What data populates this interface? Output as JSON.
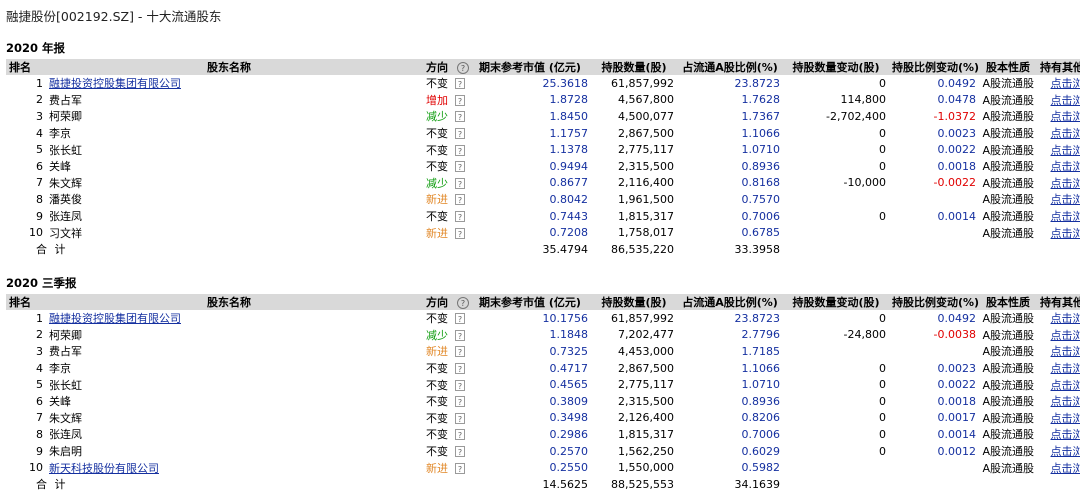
{
  "page": {
    "title": "融捷股份[002192.SZ] - 十大流通股东"
  },
  "columns": {
    "rank": "排名",
    "name": "股东名称",
    "direction": "方向",
    "help": "?",
    "market_value": "期末参考市值 (亿元)",
    "shares": "持股数量(股)",
    "ratio": "占流通A股比例(%)",
    "share_change": "持股数量变动(股)",
    "ratio_change": "持股比例变动(%)",
    "nature": "股本性质",
    "other": "持有其他股票"
  },
  "sections": [
    {
      "title": "2020 年报",
      "rows": [
        {
          "rank": "1",
          "name": "融捷投资控股集团有限公司",
          "linked": true,
          "direction": "不变",
          "dir_type": "same",
          "help": "?",
          "market_value": "25.3618",
          "shares": "61,857,992",
          "ratio": "23.8723",
          "share_change": "0",
          "ratio_change": "0.0492",
          "nature": "A股流通股",
          "other": "点击浏览"
        },
        {
          "rank": "2",
          "name": "费占军",
          "linked": false,
          "direction": "增加",
          "dir_type": "up",
          "help": "?",
          "market_value": "1.8728",
          "shares": "4,567,800",
          "ratio": "1.7628",
          "share_change": "114,800",
          "ratio_change": "0.0478",
          "nature": "A股流通股",
          "other": "点击浏览"
        },
        {
          "rank": "3",
          "name": "柯荣卿",
          "linked": false,
          "direction": "减少",
          "dir_type": "down",
          "help": "?",
          "market_value": "1.8450",
          "shares": "4,500,077",
          "ratio": "1.7367",
          "share_change": "-2,702,400",
          "ratio_change": "-1.0372",
          "nature": "A股流通股",
          "other": "点击浏览"
        },
        {
          "rank": "4",
          "name": "李京",
          "linked": false,
          "direction": "不变",
          "dir_type": "same",
          "help": "?",
          "market_value": "1.1757",
          "shares": "2,867,500",
          "ratio": "1.1066",
          "share_change": "0",
          "ratio_change": "0.0023",
          "nature": "A股流通股",
          "other": "点击浏览"
        },
        {
          "rank": "5",
          "name": "张长虹",
          "linked": false,
          "direction": "不变",
          "dir_type": "same",
          "help": "?",
          "market_value": "1.1378",
          "shares": "2,775,117",
          "ratio": "1.0710",
          "share_change": "0",
          "ratio_change": "0.0022",
          "nature": "A股流通股",
          "other": "点击浏览"
        },
        {
          "rank": "6",
          "name": "关峰",
          "linked": false,
          "direction": "不变",
          "dir_type": "same",
          "help": "?",
          "market_value": "0.9494",
          "shares": "2,315,500",
          "ratio": "0.8936",
          "share_change": "0",
          "ratio_change": "0.0018",
          "nature": "A股流通股",
          "other": "点击浏览"
        },
        {
          "rank": "7",
          "name": "朱文辉",
          "linked": false,
          "direction": "减少",
          "dir_type": "down",
          "help": "?",
          "market_value": "0.8677",
          "shares": "2,116,400",
          "ratio": "0.8168",
          "share_change": "-10,000",
          "ratio_change": "-0.0022",
          "nature": "A股流通股",
          "other": "点击浏览"
        },
        {
          "rank": "8",
          "name": "潘英俊",
          "linked": false,
          "direction": "新进",
          "dir_type": "new",
          "help": "?",
          "market_value": "0.8042",
          "shares": "1,961,500",
          "ratio": "0.7570",
          "share_change": "",
          "ratio_change": "",
          "nature": "A股流通股",
          "other": "点击浏览"
        },
        {
          "rank": "9",
          "name": "张连凤",
          "linked": false,
          "direction": "不变",
          "dir_type": "same",
          "help": "?",
          "market_value": "0.7443",
          "shares": "1,815,317",
          "ratio": "0.7006",
          "share_change": "0",
          "ratio_change": "0.0014",
          "nature": "A股流通股",
          "other": "点击浏览"
        },
        {
          "rank": "10",
          "name": "习文祥",
          "linked": false,
          "direction": "新进",
          "dir_type": "new",
          "help": "?",
          "market_value": "0.7208",
          "shares": "1,758,017",
          "ratio": "0.6785",
          "share_change": "",
          "ratio_change": "",
          "nature": "A股流通股",
          "other": "点击浏览"
        }
      ],
      "total": {
        "label": "合 计",
        "market_value": "35.4794",
        "shares": "86,535,220",
        "ratio": "33.3958"
      }
    },
    {
      "title": "2020 三季报",
      "rows": [
        {
          "rank": "1",
          "name": "融捷投资控股集团有限公司",
          "linked": true,
          "direction": "不变",
          "dir_type": "same",
          "help": "?",
          "market_value": "10.1756",
          "shares": "61,857,992",
          "ratio": "23.8723",
          "share_change": "0",
          "ratio_change": "0.0492",
          "nature": "A股流通股",
          "other": "点击浏览"
        },
        {
          "rank": "2",
          "name": "柯荣卿",
          "linked": false,
          "direction": "减少",
          "dir_type": "down",
          "help": "?",
          "market_value": "1.1848",
          "shares": "7,202,477",
          "ratio": "2.7796",
          "share_change": "-24,800",
          "ratio_change": "-0.0038",
          "nature": "A股流通股",
          "other": "点击浏览"
        },
        {
          "rank": "3",
          "name": "费占军",
          "linked": false,
          "direction": "新进",
          "dir_type": "new",
          "help": "?",
          "market_value": "0.7325",
          "shares": "4,453,000",
          "ratio": "1.7185",
          "share_change": "",
          "ratio_change": "",
          "nature": "A股流通股",
          "other": "点击浏览"
        },
        {
          "rank": "4",
          "name": "李京",
          "linked": false,
          "direction": "不变",
          "dir_type": "same",
          "help": "?",
          "market_value": "0.4717",
          "shares": "2,867,500",
          "ratio": "1.1066",
          "share_change": "0",
          "ratio_change": "0.0023",
          "nature": "A股流通股",
          "other": "点击浏览"
        },
        {
          "rank": "5",
          "name": "张长虹",
          "linked": false,
          "direction": "不变",
          "dir_type": "same",
          "help": "?",
          "market_value": "0.4565",
          "shares": "2,775,117",
          "ratio": "1.0710",
          "share_change": "0",
          "ratio_change": "0.0022",
          "nature": "A股流通股",
          "other": "点击浏览"
        },
        {
          "rank": "6",
          "name": "关峰",
          "linked": false,
          "direction": "不变",
          "dir_type": "same",
          "help": "?",
          "market_value": "0.3809",
          "shares": "2,315,500",
          "ratio": "0.8936",
          "share_change": "0",
          "ratio_change": "0.0018",
          "nature": "A股流通股",
          "other": "点击浏览"
        },
        {
          "rank": "7",
          "name": "朱文辉",
          "linked": false,
          "direction": "不变",
          "dir_type": "same",
          "help": "?",
          "market_value": "0.3498",
          "shares": "2,126,400",
          "ratio": "0.8206",
          "share_change": "0",
          "ratio_change": "0.0017",
          "nature": "A股流通股",
          "other": "点击浏览"
        },
        {
          "rank": "8",
          "name": "张连凤",
          "linked": false,
          "direction": "不变",
          "dir_type": "same",
          "help": "?",
          "market_value": "0.2986",
          "shares": "1,815,317",
          "ratio": "0.7006",
          "share_change": "0",
          "ratio_change": "0.0014",
          "nature": "A股流通股",
          "other": "点击浏览"
        },
        {
          "rank": "9",
          "name": "朱启明",
          "linked": false,
          "direction": "不变",
          "dir_type": "same",
          "help": "?",
          "market_value": "0.2570",
          "shares": "1,562,250",
          "ratio": "0.6029",
          "share_change": "0",
          "ratio_change": "0.0012",
          "nature": "A股流通股",
          "other": "点击浏览"
        },
        {
          "rank": "10",
          "name": "新天科技股份有限公司",
          "linked": true,
          "direction": "新进",
          "dir_type": "new",
          "help": "?",
          "market_value": "0.2550",
          "shares": "1,550,000",
          "ratio": "0.5982",
          "share_change": "",
          "ratio_change": "",
          "nature": "A股流通股",
          "other": "点击浏览"
        }
      ],
      "total": {
        "label": "合 计",
        "market_value": "14.5625",
        "shares": "88,525,553",
        "ratio": "34.1639"
      }
    }
  ],
  "colors": {
    "header_bg": "#d9d9d9",
    "value_blue": "#1530a0",
    "increase_red": "#e00000",
    "decrease_green": "#0a9b0a",
    "new_orange": "#e28a2b"
  }
}
